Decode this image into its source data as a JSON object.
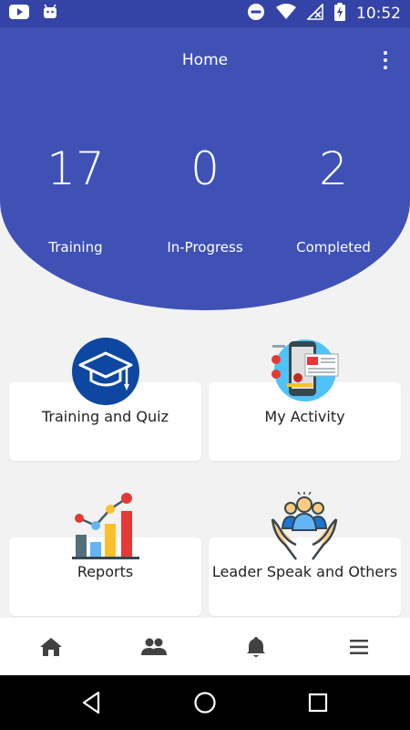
{
  "status_bar": {
    "time": "10:52",
    "icons": [
      "youtube-icon",
      "android-icon",
      "do-not-disturb-icon",
      "wifi-icon",
      "no-signal-icon",
      "battery-charging-icon"
    ]
  },
  "header": {
    "title": "Home",
    "menu_icon": "more-vertical-icon",
    "background": "#3f51b5"
  },
  "stats": [
    {
      "value": "17",
      "label": "Training"
    },
    {
      "value": "0",
      "label": "In-Progress"
    },
    {
      "value": "2",
      "label": "Completed"
    }
  ],
  "cards": [
    {
      "label": "Training and Quiz",
      "icon": "graduation-cap-icon"
    },
    {
      "label": "My Activity",
      "icon": "activity-phone-icon"
    },
    {
      "label": "Reports",
      "icon": "bar-chart-icon"
    },
    {
      "label": "Leader Speak and Others",
      "icon": "leader-hands-icon"
    }
  ],
  "bottom_nav": [
    {
      "icon": "home-icon"
    },
    {
      "icon": "people-icon"
    },
    {
      "icon": "bell-icon"
    },
    {
      "icon": "hamburger-menu-icon"
    }
  ],
  "system_nav": [
    "back-icon",
    "home-circle-icon",
    "recents-icon"
  ]
}
